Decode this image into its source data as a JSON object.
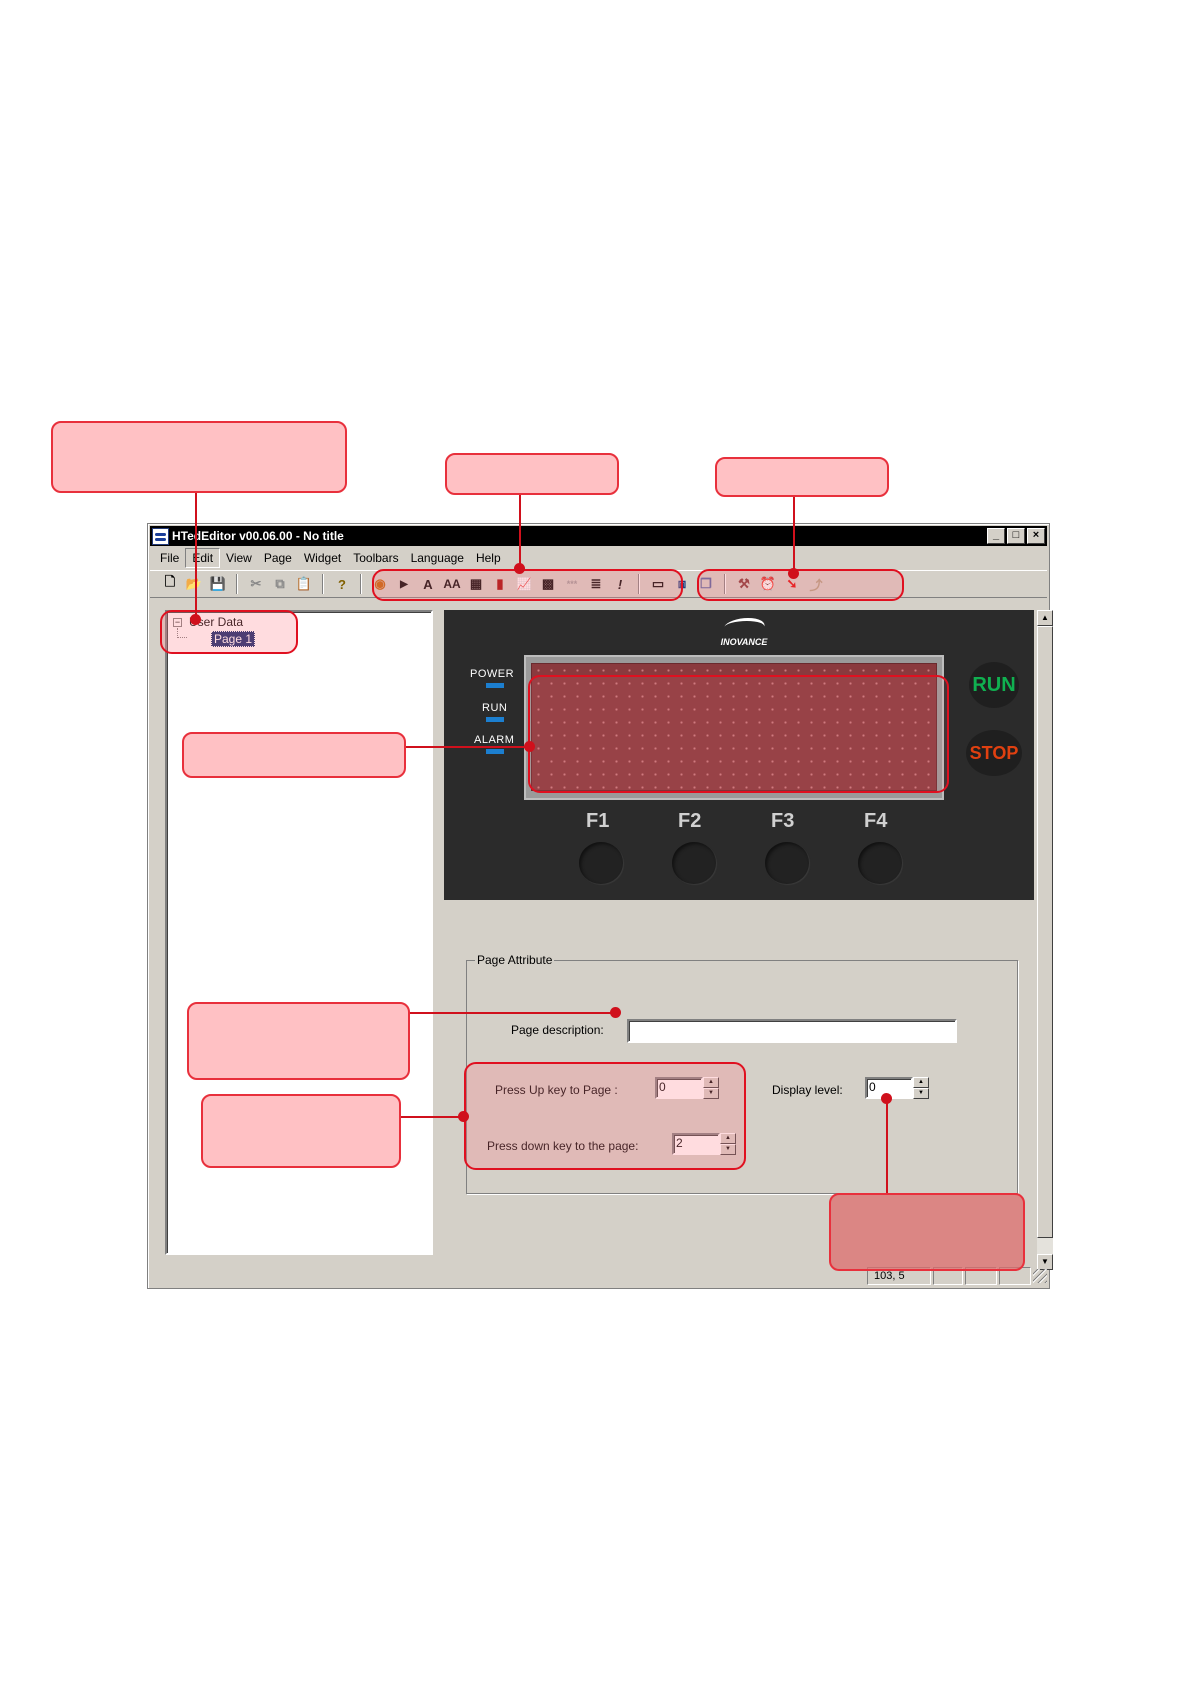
{
  "window": {
    "title": "HTedEditor v00.06.00 - No title",
    "controls": [
      "_",
      "□",
      "×"
    ]
  },
  "menu": [
    "File",
    "Edit",
    "View",
    "Page",
    "Widget",
    "Toolbars",
    "Language",
    "Help"
  ],
  "toolbar": {
    "file_tools": [
      {
        "name": "new-icon",
        "glyph": "🗋"
      },
      {
        "name": "open-icon",
        "glyph": "📂"
      },
      {
        "name": "save-icon",
        "glyph": "💾"
      }
    ],
    "edit_tools": [
      {
        "name": "cut-icon",
        "glyph": "✂"
      },
      {
        "name": "copy-icon",
        "glyph": "⧉"
      },
      {
        "name": "paste-icon",
        "glyph": "📋"
      }
    ],
    "help_tool": {
      "name": "help-icon",
      "glyph": "?"
    },
    "widget_tools": [
      {
        "name": "lamp-widget-icon",
        "glyph": "◉"
      },
      {
        "name": "button-widget-icon",
        "glyph": "▶"
      },
      {
        "name": "text-widget-icon",
        "glyph": "A"
      },
      {
        "name": "big-text-widget-icon",
        "glyph": "AA"
      },
      {
        "name": "numeric-widget-icon",
        "glyph": "▦"
      },
      {
        "name": "bar-widget-icon",
        "glyph": "▮"
      },
      {
        "name": "trend-widget-icon",
        "glyph": "📈"
      },
      {
        "name": "picture-widget-icon",
        "glyph": "▩"
      },
      {
        "name": "password-widget-icon",
        "glyph": "***"
      },
      {
        "name": "list-widget-icon",
        "glyph": "≣"
      },
      {
        "name": "alarm-text-widget-icon",
        "glyph": "!"
      }
    ],
    "page_tools": [
      {
        "name": "page-icon",
        "glyph": "▭"
      },
      {
        "name": "multi-page-icon",
        "glyph": "⧈"
      },
      {
        "name": "copy-page-icon",
        "glyph": "❐"
      },
      {
        "name": "compile-icon",
        "glyph": "⚒"
      },
      {
        "name": "alarm-clock-icon",
        "glyph": "⏰"
      },
      {
        "name": "download-arrow-icon",
        "glyph": "➘"
      },
      {
        "name": "upload-icon",
        "glyph": "⤴"
      }
    ]
  },
  "tree": {
    "expander": "−",
    "root": "User Data",
    "children": [
      "Page 1"
    ]
  },
  "device": {
    "logo": "INOVANCE",
    "leds": [
      "POWER",
      "RUN",
      "ALARM"
    ],
    "run_button": "RUN",
    "stop_button": "STOP",
    "function_keys": [
      "F1",
      "F2",
      "F3",
      "F4"
    ]
  },
  "page_attribute": {
    "group_title": "Page Attribute",
    "description_label": "Page description:",
    "description_value": "",
    "up_key_label": "Press Up key to Page :",
    "up_key_value": "0",
    "down_key_label": "Press down key to the page:",
    "down_key_value": "2",
    "display_level_label": "Display level:",
    "display_level_value": "0"
  },
  "status": {
    "coords": "103,   5"
  },
  "colors": {
    "callout_border": "#e8303c",
    "callout_fill": "#ffa0a5",
    "lcd": "#8a3a3e",
    "run_text": "#10b050",
    "stop_text": "#e04010",
    "led": "#1c7fd0"
  }
}
